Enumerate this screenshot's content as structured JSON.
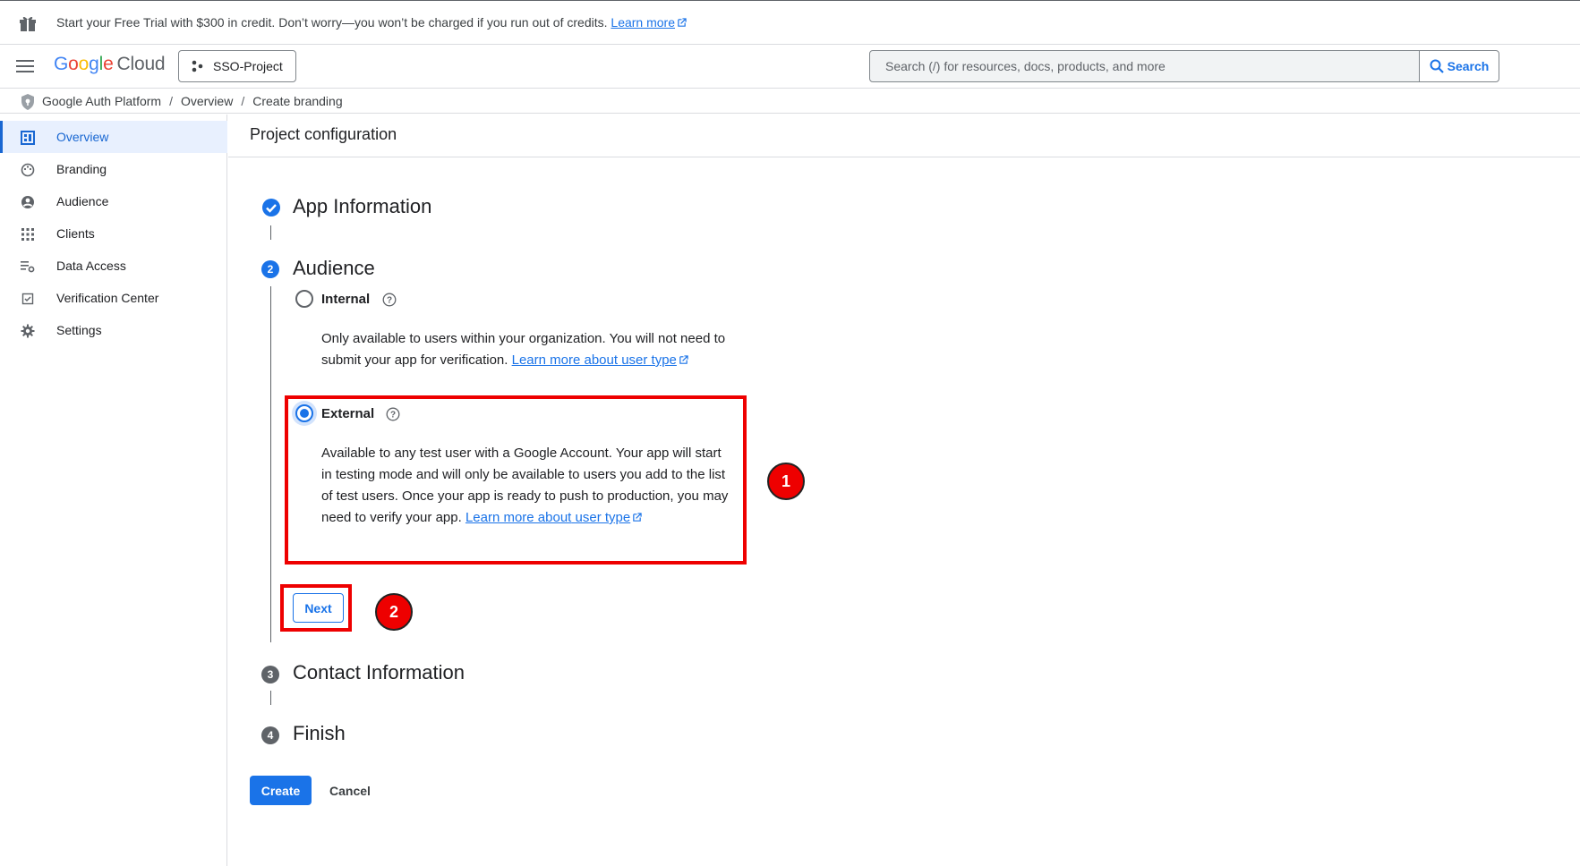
{
  "banner": {
    "text": "Start your Free Trial with $300 in credit. Don’t worry—you won’t be charged if you run out of credits.",
    "link": "Learn more"
  },
  "header": {
    "logo_google": [
      "G",
      "o",
      "o",
      "g",
      "l",
      "e"
    ],
    "logo_cloud": "Cloud",
    "project": "SSO-Project",
    "search_placeholder": "Search (/) for resources, docs, products, and more",
    "search_button": "Search"
  },
  "breadcrumb": {
    "items": [
      "Google Auth Platform",
      "Overview",
      "Create branding"
    ],
    "separator": "/"
  },
  "sidebar": {
    "items": [
      {
        "label": "Overview",
        "icon": "dashboard-icon",
        "active": true
      },
      {
        "label": "Branding",
        "icon": "palette-icon",
        "active": false
      },
      {
        "label": "Audience",
        "icon": "account-circle-icon",
        "active": false
      },
      {
        "label": "Clients",
        "icon": "apps-grid-icon",
        "active": false
      },
      {
        "label": "Data Access",
        "icon": "data-settings-icon",
        "active": false
      },
      {
        "label": "Verification Center",
        "icon": "verification-icon",
        "active": false
      },
      {
        "label": "Settings",
        "icon": "gear-icon",
        "active": false
      }
    ]
  },
  "main": {
    "title": "Project configuration",
    "steps": [
      {
        "number": "1",
        "title": "App Information",
        "state": "complete"
      },
      {
        "number": "2",
        "title": "Audience",
        "state": "active"
      },
      {
        "number": "3",
        "title": "Contact Information",
        "state": "pending"
      },
      {
        "number": "4",
        "title": "Finish",
        "state": "pending"
      }
    ],
    "audience": {
      "internal_label": "Internal",
      "internal_desc": "Only available to users within your organization. You will not need to submit your app for verification.",
      "internal_link1": "Learn more about",
      "internal_link2": "user type",
      "external_label": "External",
      "external_desc": "Available to any test user with a Google Account. Your app will start in testing mode and will only be available to users you add to the list of test users. Once your app is ready to push to production, you may need to verify your app.",
      "external_link1": "Learn more about",
      "external_link2": "user type",
      "selected": "External"
    },
    "next_button": "Next",
    "create_button": "Create",
    "cancel_button": "Cancel"
  },
  "annotations": {
    "badge1": "1",
    "badge2": "2",
    "highlight_color": "#ee0000"
  },
  "colors": {
    "accent": "#1a73e8",
    "active_bg": "#e8f0fe"
  }
}
